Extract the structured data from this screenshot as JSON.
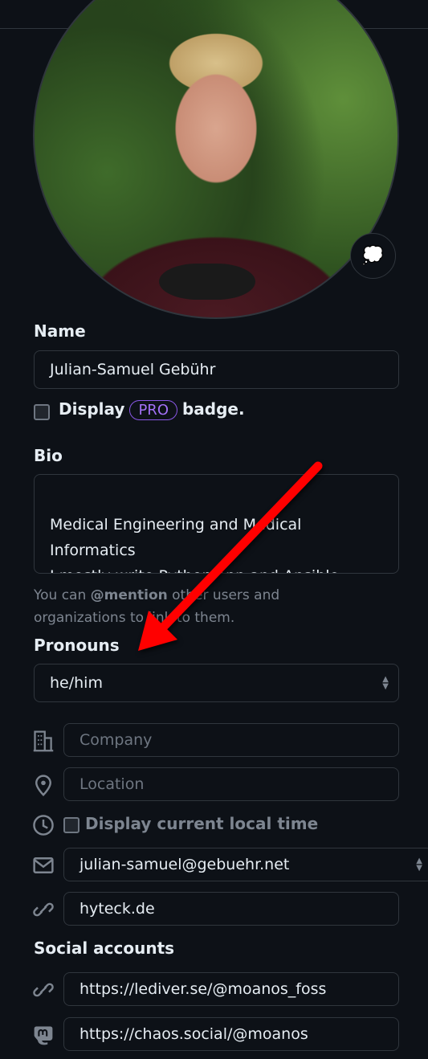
{
  "avatar": {
    "emoji_icon": "thought-bubble-icon",
    "emoji_glyph": "💭"
  },
  "name": {
    "label": "Name",
    "value": "Julian-Samuel Gebühr"
  },
  "pro_badge": {
    "prefix": "Display",
    "badge": "PRO",
    "suffix": "badge.",
    "checked": false
  },
  "bio": {
    "label": "Bio",
    "value": "\nMedical Engineering and Medical Informatics\nI mostly write Python app and Ansible"
  },
  "bio_note": {
    "pre": "You can ",
    "mention": "@mention",
    "post": " other users and organizations to link to them."
  },
  "pronouns": {
    "label": "Pronouns",
    "value": "he/him"
  },
  "company": {
    "placeholder": "Company",
    "icon": "building-icon"
  },
  "location": {
    "placeholder": "Location",
    "icon": "location-pin-icon"
  },
  "local_time": {
    "label": "Display current local time",
    "checked": false,
    "icon": "clock-icon"
  },
  "email": {
    "value": "julian-samuel@gebuehr.net",
    "icon": "mail-icon"
  },
  "website": {
    "value": "hyteck.de",
    "icon": "link-icon"
  },
  "social": {
    "label": "Social accounts",
    "accounts": [
      {
        "value": "https://lediver.se/@moanos_foss",
        "icon": "link-icon"
      },
      {
        "value": "https://chaos.social/@moanos",
        "icon": "mastodon-icon"
      }
    ]
  },
  "colors": {
    "background": "#0d1117",
    "border": "#30363d",
    "pro": "#a371f7",
    "arrow": "#ff0000"
  }
}
